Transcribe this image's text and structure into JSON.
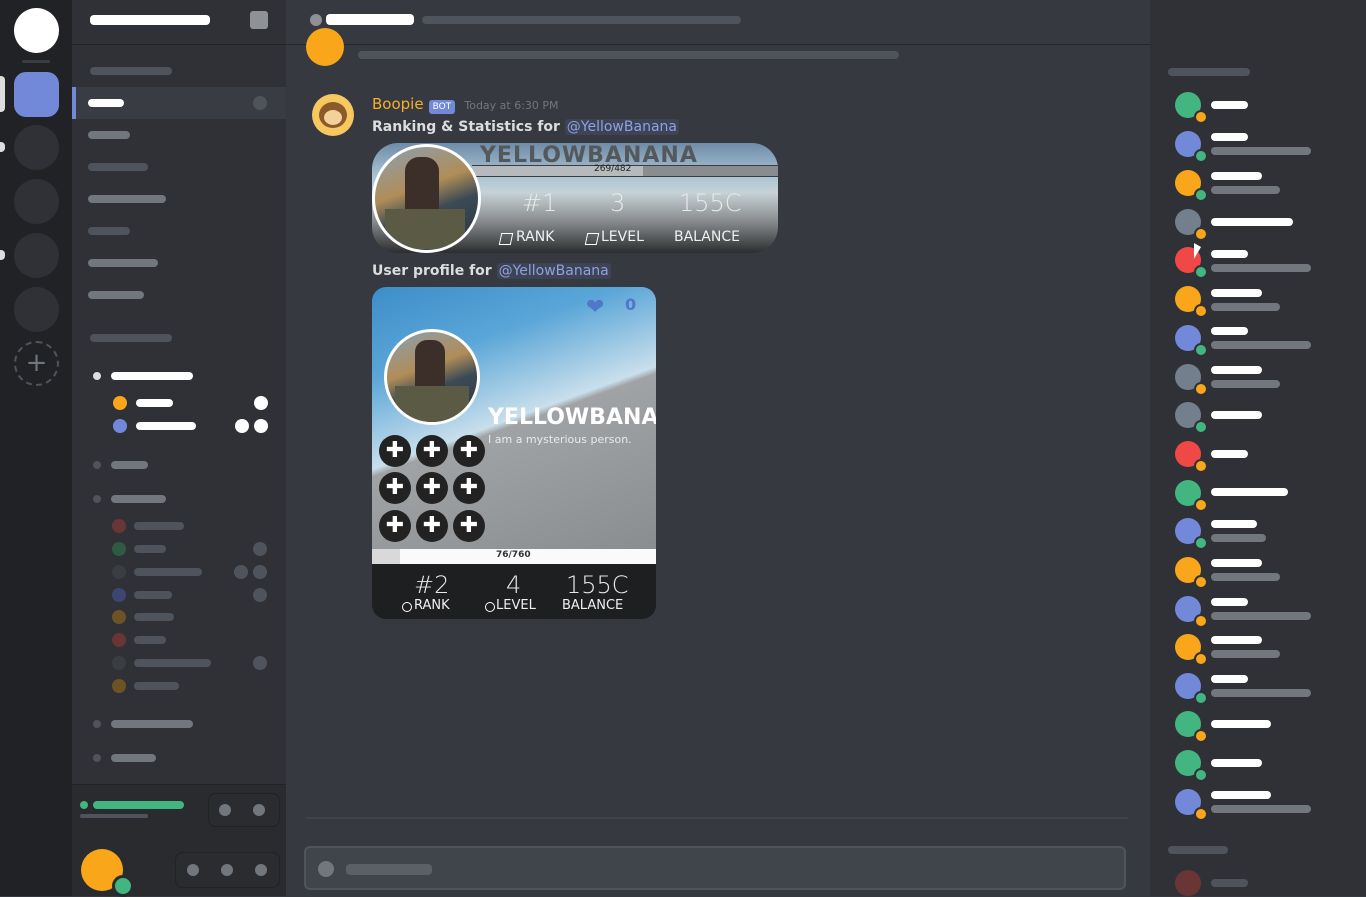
{
  "message": {
    "author": "Boopie",
    "bot_tag": "BOT",
    "timestamp": "Today at 6:30 PM",
    "line1_prefix": "Ranking & Statistics for ",
    "line1_mention": "@YellowBanana",
    "line2_prefix": "User profile for ",
    "line2_mention": "@YellowBanana"
  },
  "rank_card": {
    "username": "YELLOWBANANA",
    "xp_text": "269/482",
    "xp_progress": 0.56,
    "rank_value": "#1",
    "level_value": "3",
    "balance_value": "155C",
    "rank_label": "RANK",
    "level_label": "LEVEL",
    "balance_label": "BALANCE"
  },
  "profile_card": {
    "username": "YELLOWBANANA",
    "bio": "I am a mysterious person.",
    "likes": "0",
    "xp_text": "76/760",
    "xp_progress": 0.1,
    "rank_value": "#2",
    "level_value": "4",
    "balance_value": "155C",
    "rank_label": "RANK",
    "level_label": "LEVEL",
    "balance_label": "BALANCE",
    "badge_glyph": "✚"
  },
  "colors": {
    "rail_bg": "#202225",
    "sidebar_bg": "#2f3136",
    "chat_bg": "#36393f",
    "blurple": "#7289da",
    "author_color": "#f6b02d",
    "online": "#43b581",
    "idle": "#faa61a",
    "dnd": "#f04747"
  },
  "icons": {
    "add_server": "plus-icon",
    "heart": "heart-icon",
    "globe": "globe-icon",
    "cube": "cube-icon"
  }
}
